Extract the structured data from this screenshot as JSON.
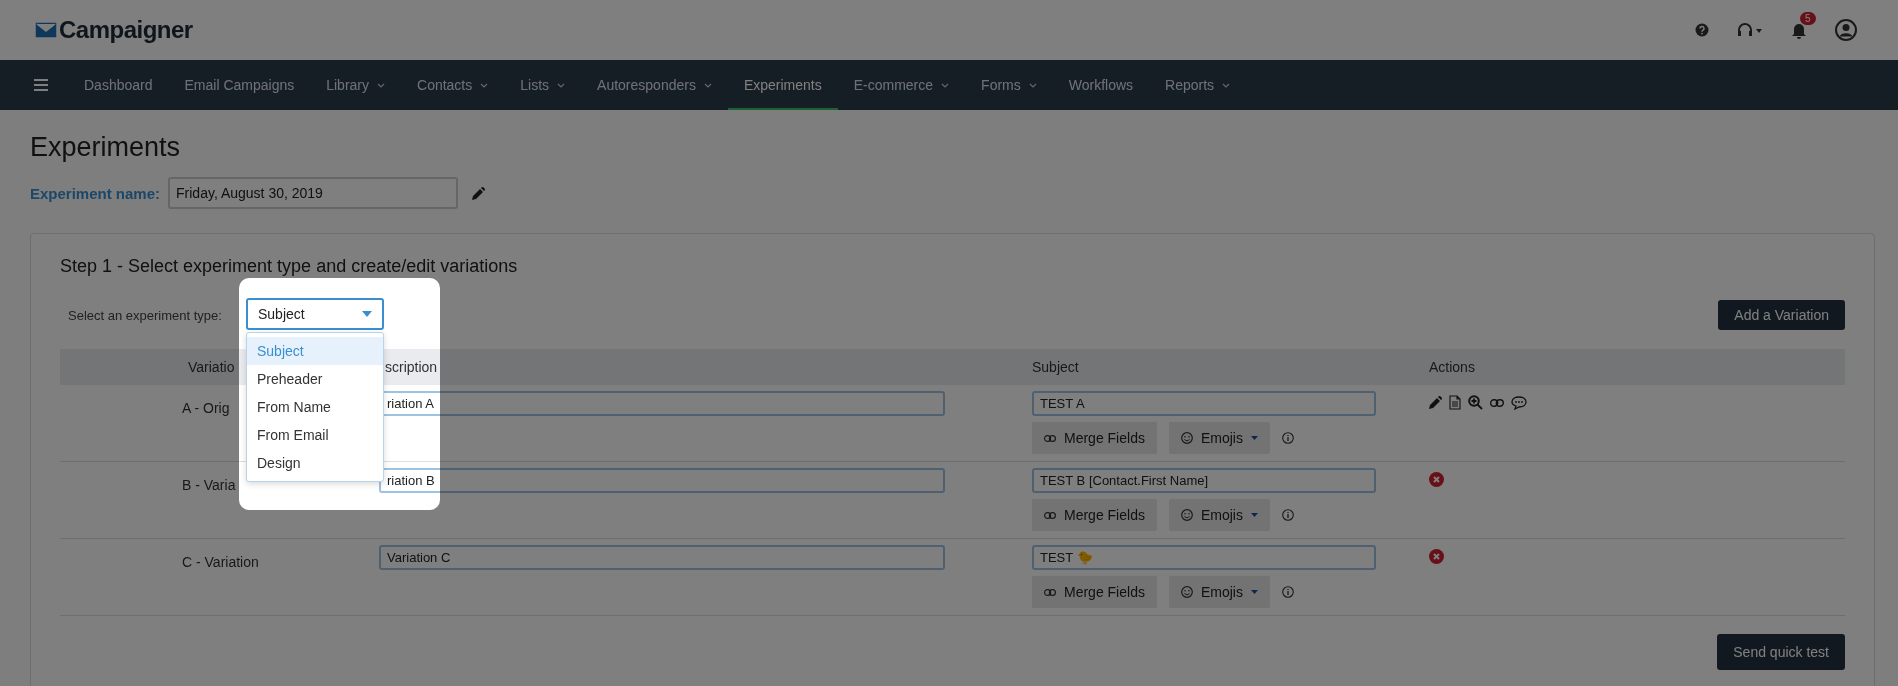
{
  "header": {
    "logo": "Campaigner",
    "notification_count": "5"
  },
  "nav": [
    {
      "label": "Dashboard",
      "has_menu": false,
      "selected": false
    },
    {
      "label": "Email Campaigns",
      "has_menu": false,
      "selected": false
    },
    {
      "label": "Library",
      "has_menu": true,
      "selected": false
    },
    {
      "label": "Contacts",
      "has_menu": true,
      "selected": false
    },
    {
      "label": "Lists",
      "has_menu": true,
      "selected": false
    },
    {
      "label": "Autoresponders",
      "has_menu": true,
      "selected": false
    },
    {
      "label": "Experiments",
      "has_menu": false,
      "selected": true
    },
    {
      "label": "E-commerce",
      "has_menu": true,
      "selected": false
    },
    {
      "label": "Forms",
      "has_menu": true,
      "selected": false
    },
    {
      "label": "Workflows",
      "has_menu": false,
      "selected": false
    },
    {
      "label": "Reports",
      "has_menu": true,
      "selected": false
    }
  ],
  "page_title": "Experiments",
  "experiment_name": {
    "label": "Experiment name:",
    "value": "Friday, August 30, 2019"
  },
  "step": {
    "title": "Step 1 - Select experiment type and create/edit variations",
    "type_label": "Select an experiment type:",
    "type_value": "Subject",
    "add_button": "Add a Variation"
  },
  "type_options": [
    {
      "label": "Subject",
      "selected": true
    },
    {
      "label": "Preheader",
      "selected": false
    },
    {
      "label": "From Name",
      "selected": false
    },
    {
      "label": "From Email",
      "selected": false
    },
    {
      "label": "Design",
      "selected": false
    }
  ],
  "table": {
    "columns": [
      "Variatio",
      "scription",
      "Subject",
      "Actions"
    ],
    "rows": [
      {
        "kind": "original",
        "variation": "A - Orig",
        "description": "riation A",
        "subject": "TEST A",
        "merge_button": "Merge Fields",
        "emoji_button": "Emojis"
      },
      {
        "kind": "variant",
        "variation": "B - Varia",
        "description": "riation B",
        "subject": "TEST B [Contact.First Name]",
        "merge_button": "Merge Fields",
        "emoji_button": "Emojis"
      },
      {
        "kind": "variant",
        "variation": "C - Variation",
        "description": "Variation C",
        "subject": "TEST 🐤",
        "merge_button": "Merge Fields",
        "emoji_button": "Emojis"
      }
    ]
  },
  "send_button": "Send quick test"
}
